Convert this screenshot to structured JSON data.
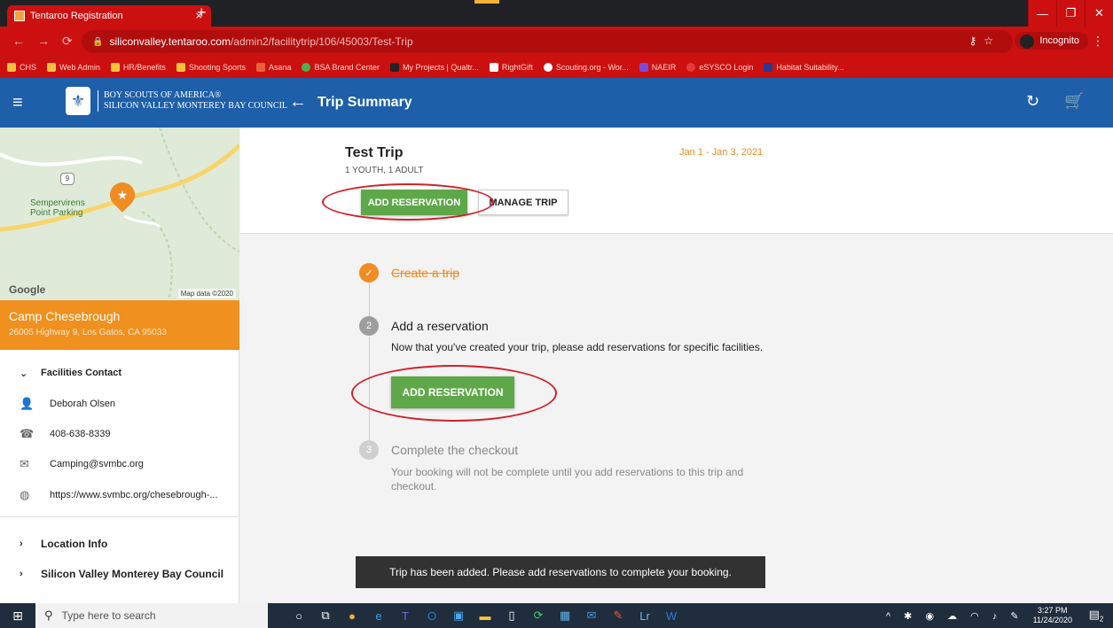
{
  "browser": {
    "tab_title": "Tentaroo Registration",
    "tab_close": "×",
    "new_tab": "+",
    "url_host": "siliconvalley.tentaroo.com",
    "url_path": "/admin2/facilitytrip/106/45003/Test-Trip",
    "incognito_label": "Incognito",
    "bookmarks": [
      "CHS",
      "Web Admin",
      "HR/Benefits",
      "Shooting Sports",
      "Asana",
      "BSA Brand Center",
      "My Projects | Qualtr...",
      "RightGift",
      "Scouting.org - Wor...",
      "NAEIR",
      "eSYSCO Login",
      "Habitat Suitability..."
    ]
  },
  "app": {
    "org_line1": "BOY SCOUTS OF AMERICA®",
    "org_line2": "SILICON VALLEY MONTEREY BAY COUNCIL",
    "title": "Trip Summary"
  },
  "sidebar": {
    "map_label_line1": "Sempervirens",
    "map_label_line2": "Point Parking",
    "map_route": "9",
    "map_provider": "Google",
    "map_data": "Map data ©2020",
    "camp_name": "Camp Chesebrough",
    "camp_address": "26005 Highway 9, Los Gatos, CA 95033",
    "facilities_contact": "Facilities Contact",
    "contact_name": "Deborah Olsen",
    "contact_phone": "408-638-8339",
    "contact_email": "Camping@svmbc.org",
    "contact_url": "https://www.svmbc.org/chesebrough-...",
    "location_info": "Location Info",
    "council": "Silicon Valley Monterey Bay Council"
  },
  "trip": {
    "name": "Test Trip",
    "people": "1 YOUTH, 1 ADULT",
    "dates": "Jan 1 - Jan 3, 2021",
    "add_reservation_label": "ADD RESERVATION",
    "manage_trip_label": "MANAGE TRIP"
  },
  "steps": [
    {
      "number": "✓",
      "title": "Create a trip",
      "desc": ""
    },
    {
      "number": "2",
      "title": "Add a reservation",
      "desc": "Now that you've created your trip, please add reservations for specific facilities."
    },
    {
      "number": "3",
      "title": "Complete the checkout",
      "desc": "Your booking will not be complete until you add reservations to this trip and checkout."
    }
  ],
  "step2_button_label": "ADD RESERVATION",
  "toast": "Trip has been added. Please add reservations to complete your booking.",
  "taskbar": {
    "search_placeholder": "Type here to search",
    "time": "3:27 PM",
    "date": "11/24/2020",
    "notif_count": "2"
  },
  "colors": {
    "header_blue": "#1d5fa8",
    "accent_orange": "#f0901e",
    "button_green": "#5fa84a",
    "browser_red": "#cc1010",
    "annotation_red": "#d0202a"
  }
}
